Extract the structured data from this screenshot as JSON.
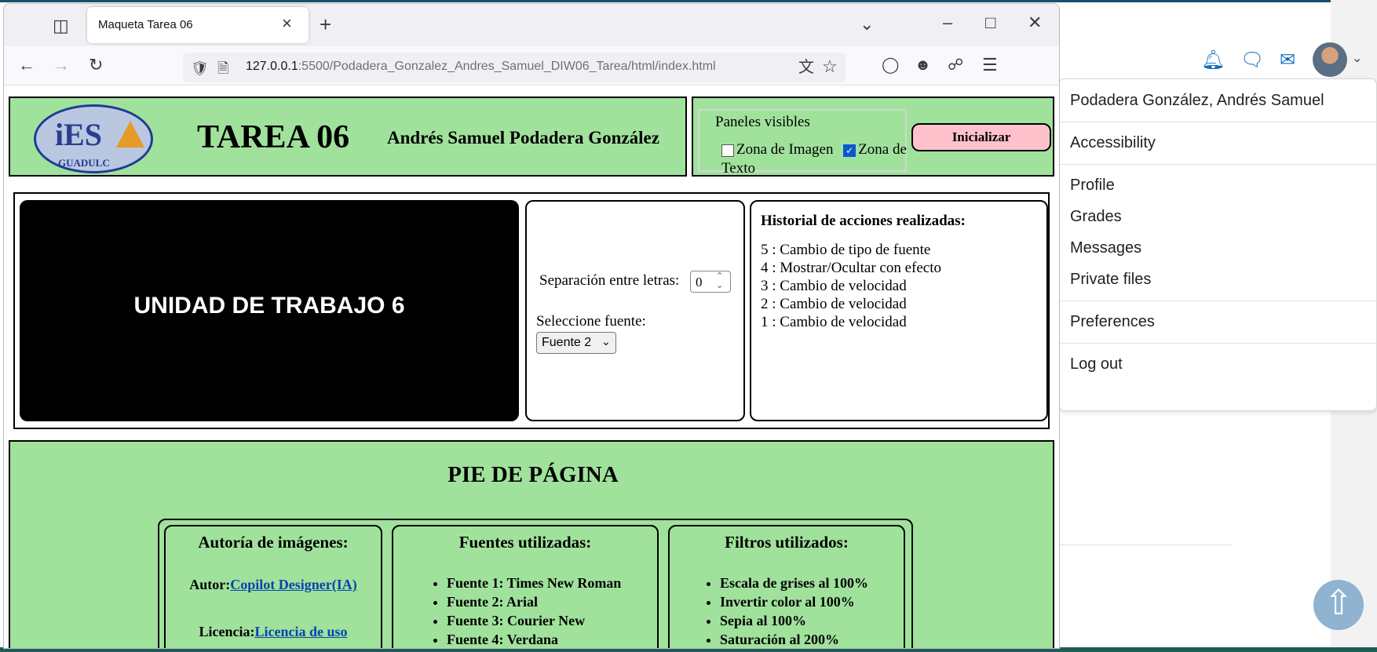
{
  "browser": {
    "tab_title": "Maqueta Tarea 06",
    "url_host": "127.0.0.1",
    "url_rest": ":5500/Podadera_Gonzalez_Andres_Samuel_DIW06_Tarea/html/index.html"
  },
  "header": {
    "logo_text": "iES",
    "logo_sub": "GUADULC",
    "title": "TAREA 06",
    "author": "Andrés Samuel Podadera González"
  },
  "panels": {
    "legend": "Paneles visibles",
    "image_zone": "Zona de Imagen",
    "text_zone": "Zona de Texto",
    "image_checked": false,
    "text_checked": true,
    "init_button": "Inicializar"
  },
  "main": {
    "image_text": "UNIDAD DE TRABAJO 6",
    "spacing_label": "Separación entre letras:",
    "spacing_value": "0",
    "font_label": "Seleccione fuente:",
    "font_selected": "Fuente 2",
    "history_title": "Historial de acciones realizadas:",
    "history": [
      "5 : Cambio de tipo de fuente",
      "4 : Mostrar/Ocultar con efecto",
      "3 : Cambio de velocidad",
      "2 : Cambio de velocidad",
      "1 : Cambio de velocidad"
    ]
  },
  "footer": {
    "title": "PIE DE PÁGINA",
    "authorship_title": "Autoría de imágenes:",
    "author_label": "Autor:",
    "author_link": "Copilot Designer(IA)",
    "license_label": "Licencia:",
    "license_link": "Licencia de uso",
    "fonts_title": "Fuentes utilizadas:",
    "fonts": [
      "Fuente 1: Times New Roman",
      "Fuente 2: Arial",
      "Fuente 3: Courier New",
      "Fuente 4: Verdana"
    ],
    "filters_title": "Filtros utilizados:",
    "filters": [
      "Escala de grises al 100%",
      "Invertir color al 100%",
      "Sepia al 100%",
      "Saturación al 200%"
    ]
  },
  "user_menu": {
    "user_name": "Podadera González, Andrés Samuel",
    "accessibility": "Accessibility",
    "profile": "Profile",
    "grades": "Grades",
    "messages": "Messages",
    "private_files": "Private files",
    "preferences": "Preferences",
    "logout": "Log out"
  },
  "icons": {
    "back": "arrow-left-icon",
    "forward": "arrow-right-icon",
    "reload": "reload-icon",
    "notifications": "bell-icon",
    "chat": "chat-icon",
    "mail": "mail-icon",
    "scroll_top": "arrow-up-circle-icon"
  },
  "colors": {
    "page_green": "#a0e29c",
    "button_pink": "#ffc2cc",
    "link_blue": "#0645ad",
    "moodle_blue": "#0f6cbf"
  }
}
